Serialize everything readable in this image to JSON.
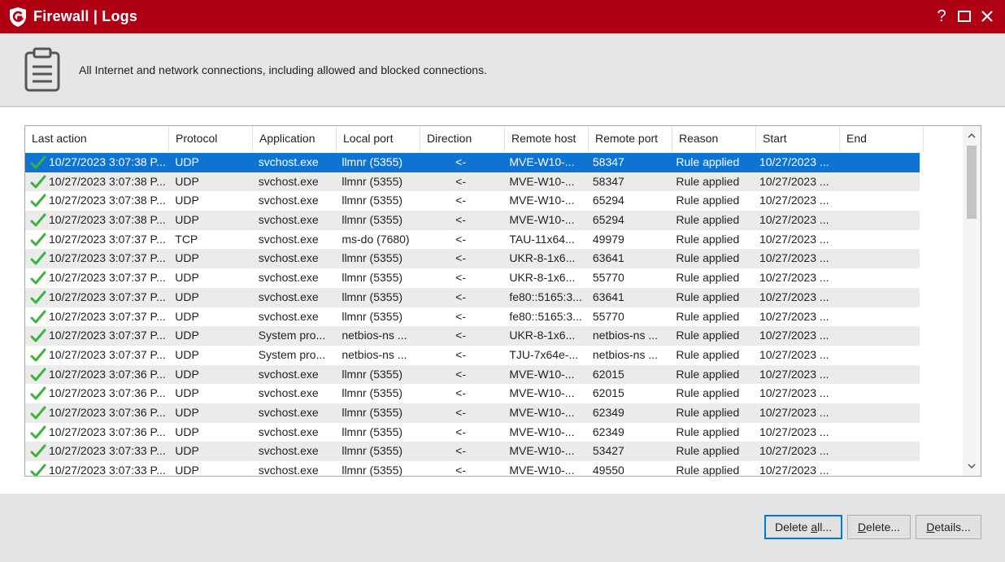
{
  "window": {
    "title": "Firewall | Logs",
    "help_glyph": "?",
    "maximize_glyph": "☐",
    "close_glyph": "✕",
    "accent_color": "#b00014",
    "selection_color": "#0f73d2",
    "icons": [
      "g-data-shield-icon",
      "clipboard-icon",
      "check-icon"
    ]
  },
  "header": {
    "description": "All Internet and network connections, including allowed and blocked connections."
  },
  "table": {
    "columns": [
      "Last action",
      "Protocol",
      "Application",
      "Local port",
      "Direction",
      "Remote host",
      "Remote port",
      "Reason",
      "Start",
      "End"
    ],
    "selected_row": 0,
    "rows": [
      [
        "10/27/2023 3:07:38 P...",
        "UDP",
        "svchost.exe",
        "llmnr (5355)",
        "<-",
        "MVE-W10-...",
        "58347",
        "Rule applied",
        "10/27/2023 ...",
        ""
      ],
      [
        "10/27/2023 3:07:38 P...",
        "UDP",
        "svchost.exe",
        "llmnr (5355)",
        "<-",
        "MVE-W10-...",
        "58347",
        "Rule applied",
        "10/27/2023 ...",
        ""
      ],
      [
        "10/27/2023 3:07:38 P...",
        "UDP",
        "svchost.exe",
        "llmnr (5355)",
        "<-",
        "MVE-W10-...",
        "65294",
        "Rule applied",
        "10/27/2023 ...",
        ""
      ],
      [
        "10/27/2023 3:07:38 P...",
        "UDP",
        "svchost.exe",
        "llmnr (5355)",
        "<-",
        "MVE-W10-...",
        "65294",
        "Rule applied",
        "10/27/2023 ...",
        ""
      ],
      [
        "10/27/2023 3:07:37 P...",
        "TCP",
        "svchost.exe",
        "ms-do (7680)",
        "<-",
        "TAU-11x64...",
        "49979",
        "Rule applied",
        "10/27/2023 ...",
        ""
      ],
      [
        "10/27/2023 3:07:37 P...",
        "UDP",
        "svchost.exe",
        "llmnr (5355)",
        "<-",
        "UKR-8-1x6...",
        "63641",
        "Rule applied",
        "10/27/2023 ...",
        ""
      ],
      [
        "10/27/2023 3:07:37 P...",
        "UDP",
        "svchost.exe",
        "llmnr (5355)",
        "<-",
        "UKR-8-1x6...",
        "55770",
        "Rule applied",
        "10/27/2023 ...",
        ""
      ],
      [
        "10/27/2023 3:07:37 P...",
        "UDP",
        "svchost.exe",
        "llmnr (5355)",
        "<-",
        "fe80::5165:3...",
        "63641",
        "Rule applied",
        "10/27/2023 ...",
        ""
      ],
      [
        "10/27/2023 3:07:37 P...",
        "UDP",
        "svchost.exe",
        "llmnr (5355)",
        "<-",
        "fe80::5165:3...",
        "55770",
        "Rule applied",
        "10/27/2023 ...",
        ""
      ],
      [
        "10/27/2023 3:07:37 P...",
        "UDP",
        "System pro...",
        "netbios-ns ...",
        "<-",
        "UKR-8-1x6...",
        "netbios-ns ...",
        "Rule applied",
        "10/27/2023 ...",
        ""
      ],
      [
        "10/27/2023 3:07:37 P...",
        "UDP",
        "System pro...",
        "netbios-ns ...",
        "<-",
        "TJU-7x64e-...",
        "netbios-ns ...",
        "Rule applied",
        "10/27/2023 ...",
        ""
      ],
      [
        "10/27/2023 3:07:36 P...",
        "UDP",
        "svchost.exe",
        "llmnr (5355)",
        "<-",
        "MVE-W10-...",
        "62015",
        "Rule applied",
        "10/27/2023 ...",
        ""
      ],
      [
        "10/27/2023 3:07:36 P...",
        "UDP",
        "svchost.exe",
        "llmnr (5355)",
        "<-",
        "MVE-W10-...",
        "62015",
        "Rule applied",
        "10/27/2023 ...",
        ""
      ],
      [
        "10/27/2023 3:07:36 P...",
        "UDP",
        "svchost.exe",
        "llmnr (5355)",
        "<-",
        "MVE-W10-...",
        "62349",
        "Rule applied",
        "10/27/2023 ...",
        ""
      ],
      [
        "10/27/2023 3:07:36 P...",
        "UDP",
        "svchost.exe",
        "llmnr (5355)",
        "<-",
        "MVE-W10-...",
        "62349",
        "Rule applied",
        "10/27/2023 ...",
        ""
      ],
      [
        "10/27/2023 3:07:33 P...",
        "UDP",
        "svchost.exe",
        "llmnr (5355)",
        "<-",
        "MVE-W10-...",
        "53427",
        "Rule applied",
        "10/27/2023 ...",
        ""
      ],
      [
        "10/27/2023 3:07:33 P...",
        "UDP",
        "svchost.exe",
        "llmnr (5355)",
        "<-",
        "MVE-W10-...",
        "49550",
        "Rule applied",
        "10/27/2023 ...",
        ""
      ]
    ]
  },
  "scrollbar": {
    "up_glyph": "⌃",
    "down_glyph": "⌄"
  },
  "buttons": {
    "delete_all": {
      "label": "Delete all...",
      "accel": "a"
    },
    "delete": {
      "label": "Delete...",
      "accel": "D"
    },
    "details": {
      "label": "Details...",
      "accel": "D"
    }
  }
}
